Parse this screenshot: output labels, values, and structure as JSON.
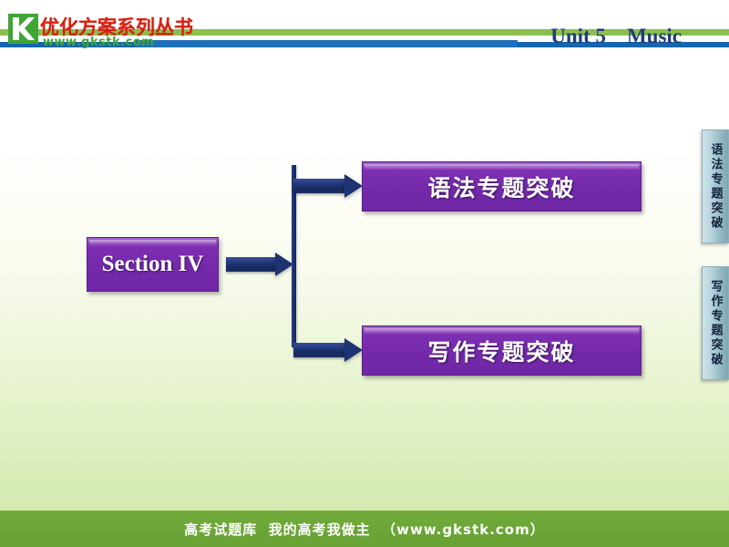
{
  "header": {
    "logo_icon": "gkstk-k-logo-icon",
    "brand_title": "优化方案系列丛书",
    "brand_url": "www.gkstk.com",
    "unit_title": "Unit 5　Music"
  },
  "diagram": {
    "root": {
      "label": "Section IV"
    },
    "branches": [
      {
        "label": "语法专题突破"
      },
      {
        "label": "写作专题突破"
      }
    ],
    "connectors": {
      "main_arrow": "arrow-right",
      "top_arrow": "arrow-right",
      "bottom_arrow": "arrow-right",
      "spine": "vertical-bracket"
    }
  },
  "side_tabs": [
    {
      "label": "语法专题突破"
    },
    {
      "label": "写作专题突破"
    }
  ],
  "footer": {
    "text": "高考试题库  我的高考我做主  （www.gkstk.com）"
  },
  "colors": {
    "rule_green": "#8cc04e",
    "rule_blue": "#1665ad",
    "brand_red": "#d81f0f",
    "brand_green": "#3fa535",
    "unit_blue": "#1f3f7a",
    "box_purple": "#7429ab",
    "arrow_navy": "#1e3371",
    "tab_teal": "#8fb6c0",
    "footer_green": "#6ca637",
    "bg_top": "#ffffff",
    "bg_bottom": "#cfe7a8"
  }
}
